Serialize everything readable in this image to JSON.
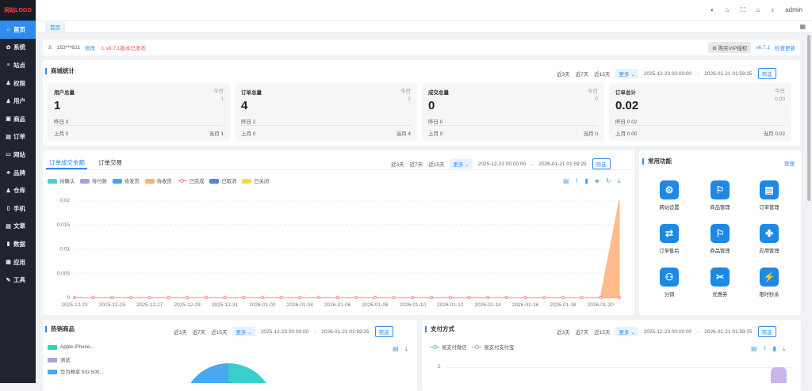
{
  "sidebar": {
    "logo": "网站LOGO",
    "items": [
      {
        "label": "首页",
        "icon": "home-icon",
        "glyph": "⌂"
      },
      {
        "label": "系统",
        "icon": "gear-icon",
        "glyph": "✿"
      },
      {
        "label": "站点",
        "icon": "sliders-icon",
        "glyph": "≡"
      },
      {
        "label": "权限",
        "icon": "lock-user-icon",
        "glyph": "♟"
      },
      {
        "label": "用户",
        "icon": "user-icon",
        "glyph": "♟"
      },
      {
        "label": "商品",
        "icon": "box-icon",
        "glyph": "▣"
      },
      {
        "label": "订单",
        "icon": "order-icon",
        "glyph": "▤"
      },
      {
        "label": "网站",
        "icon": "monitor-icon",
        "glyph": "▭"
      },
      {
        "label": "品牌",
        "icon": "brand-icon",
        "glyph": "♣"
      },
      {
        "label": "仓库",
        "icon": "warehouse-icon",
        "glyph": "♟"
      },
      {
        "label": "手机",
        "icon": "phone-icon",
        "glyph": "▯"
      },
      {
        "label": "文章",
        "icon": "article-icon",
        "glyph": "▤"
      },
      {
        "label": "数据",
        "icon": "bar-chart-icon",
        "glyph": "▮"
      },
      {
        "label": "应用",
        "icon": "apps-icon",
        "glyph": "▦"
      },
      {
        "label": "工具",
        "icon": "wrench-icon",
        "glyph": "✎"
      }
    ]
  },
  "topbar": {
    "user": "admin"
  },
  "tabs": {
    "home": "首页"
  },
  "notice": {
    "account": "153***821",
    "edit": "修改",
    "release": "v6.7.1版本已发布",
    "vip": "购买VIP授权",
    "version": "v6.7.1",
    "check_update": "检查更新"
  },
  "filters": {
    "d3": "近3天",
    "d7": "近7天",
    "d15": "近15天",
    "more": "更多 ⌄",
    "start": "2025-12-23 00:00:00",
    "sep": "-",
    "end": "2026-01-21 01:59:25",
    "filter": "筛选"
  },
  "mall_stats": {
    "title": "商城统计",
    "cards": [
      {
        "title": "用户总量",
        "today_label": "今日",
        "today": "1",
        "total": "1",
        "yesterday": "昨日  0",
        "last_month": "上月  0",
        "this_month": "当月  1"
      },
      {
        "title": "订单总量",
        "today_label": "今日",
        "today": "2",
        "total": "4",
        "yesterday": "昨日 2",
        "last_month": "上月  0",
        "this_month": "当月  4"
      },
      {
        "title": "成交总量",
        "today_label": "今日",
        "today": "0",
        "total": "0",
        "yesterday": "昨日  0",
        "last_month": "上月  0",
        "this_month": "当月  0"
      },
      {
        "title": "订单总计",
        "today_label": "今日",
        "today": "0.00",
        "total": "0.02",
        "yesterday": "昨日 0.02",
        "last_month": "上月  0.00",
        "this_month": "当月  0.02"
      }
    ]
  },
  "order_panel": {
    "tab_amount": "订单成交金额",
    "tab_trade": "订单交易",
    "legend": [
      {
        "name": "待确认",
        "kind": "area",
        "color": "#4ed0c8"
      },
      {
        "name": "待付款",
        "kind": "area",
        "color": "#b39ddb"
      },
      {
        "name": "待发货",
        "kind": "area",
        "color": "#42a5f5"
      },
      {
        "name": "待收货",
        "kind": "area",
        "color": "#ffb27a"
      },
      {
        "name": "已完成",
        "kind": "line",
        "color": "#f08080"
      },
      {
        "name": "已取消",
        "kind": "area",
        "color": "#5b7fe0"
      },
      {
        "name": "已关闭",
        "kind": "area",
        "color": "#f6d94a"
      }
    ]
  },
  "chart_data": {
    "type": "area",
    "ylim": [
      0,
      0.02
    ],
    "yticks": [
      "0.02",
      "0.015",
      "0.01",
      "0.005",
      "0"
    ],
    "x": [
      "2025-12-23",
      "2025-12-24",
      "2025-12-25",
      "2025-12-26",
      "2025-12-27",
      "2025-12-28",
      "2025-12-29",
      "2025-12-30",
      "2025-12-31",
      "2026-01-01",
      "2026-01-02",
      "2026-01-03",
      "2026-01-04",
      "2026-01-05",
      "2026-01-06",
      "2026-01-07",
      "2026-01-08",
      "2026-01-09",
      "2026-01-10",
      "2026-01-11",
      "2026-01-12",
      "2026-01-13",
      "2026-01-14",
      "2026-01-15",
      "2026-01-16",
      "2026-01-17",
      "2026-01-18",
      "2026-01-19",
      "2026-01-20",
      "2026-01-21"
    ],
    "xtick_labels": [
      "2025-12-23",
      "2025-12-25",
      "2025-12-27",
      "2025-12-29",
      "2025-12-31",
      "2026-01-02",
      "2026-01-04",
      "2026-01-06",
      "2026-01-08",
      "2026-01-10",
      "2026-01-12",
      "2026-01-14",
      "2026-01-16",
      "2026-01-18",
      "2026-01-20"
    ],
    "series": [
      {
        "name": "待收货",
        "values": [
          0,
          0,
          0,
          0,
          0,
          0,
          0,
          0,
          0,
          0,
          0,
          0,
          0,
          0,
          0,
          0,
          0,
          0,
          0,
          0,
          0,
          0,
          0,
          0,
          0,
          0,
          0,
          0,
          0,
          0.02
        ]
      },
      {
        "name": "已完成",
        "values": [
          0,
          0,
          0,
          0,
          0,
          0,
          0,
          0,
          0,
          0,
          0,
          0,
          0,
          0,
          0,
          0,
          0,
          0,
          0,
          0,
          0,
          0,
          0,
          0,
          0,
          0,
          0,
          0,
          0,
          0
        ]
      }
    ]
  },
  "quick": {
    "title": "常用功能",
    "manage": "管理",
    "items": [
      {
        "label": "网站设置",
        "icon": "site-settings-icon",
        "glyph": "⚙"
      },
      {
        "label": "商品管理",
        "icon": "goods-manage-icon",
        "glyph": "⚐"
      },
      {
        "label": "订单管理",
        "icon": "order-manage-icon",
        "glyph": "▤"
      },
      {
        "label": "订单售后",
        "icon": "after-sale-icon",
        "glyph": "⇄"
      },
      {
        "label": "商品管理",
        "icon": "goods-manage-icon-2",
        "glyph": "⚐"
      },
      {
        "label": "应用管理",
        "icon": "app-manage-icon",
        "glyph": "✤"
      },
      {
        "label": "分销",
        "icon": "distribution-icon",
        "glyph": "⚇"
      },
      {
        "label": "优惠券",
        "icon": "coupon-icon",
        "glyph": "✂"
      },
      {
        "label": "限时秒杀",
        "icon": "flash-sale-icon",
        "glyph": "⚡"
      }
    ]
  },
  "hot_goods": {
    "title": "热销商品",
    "legend": [
      {
        "name": "Apple iPhone...",
        "color": "#36cfc9"
      },
      {
        "name": "测试",
        "color": "#b39ddb"
      },
      {
        "name": "华为畅享 50z 500...",
        "color": "#4aa8f0"
      }
    ]
  },
  "payment": {
    "title": "支付方式",
    "legend": [
      {
        "name": "易支付微信",
        "color": "#36cfc9"
      },
      {
        "name": "易支付支付宝",
        "color": "#b39ddb"
      }
    ],
    "ytick": "2"
  }
}
